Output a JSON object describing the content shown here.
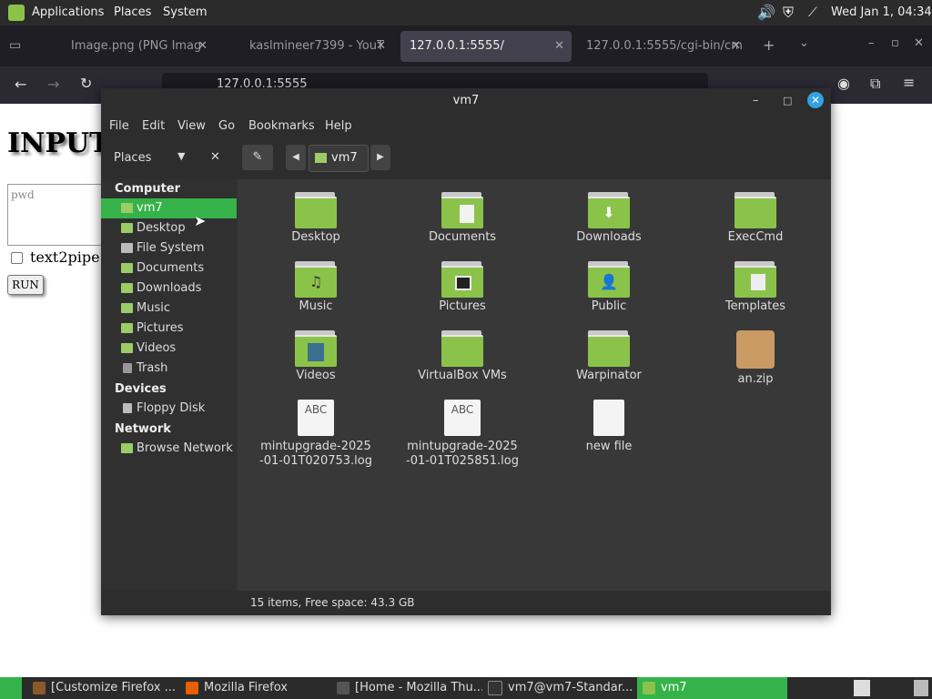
{
  "top_panel": {
    "menus": [
      "Applications",
      "Places",
      "System"
    ],
    "clock": "Wed Jan  1, 04:34"
  },
  "firefox": {
    "tabs": [
      {
        "label": "Image.png (PNG Imag",
        "active": false
      },
      {
        "label": "kaslmineer7399 - YouT",
        "active": false
      },
      {
        "label": "127.0.0.1:5555/",
        "active": true
      },
      {
        "label": "127.0.0.1:5555/cgi-bin/cm",
        "active": false
      }
    ],
    "url": "127.0.0.1:5555"
  },
  "page": {
    "heading": "INPUT",
    "textarea_placeholder": "pwd",
    "checkbox_label": "text2pipe",
    "run_label": "RUN"
  },
  "nemo": {
    "title": "vm7",
    "menu": [
      "File",
      "Edit",
      "View",
      "Go",
      "Bookmarks",
      "Help"
    ],
    "places_label": "Places",
    "path_button": "vm7",
    "sidebar": {
      "computer_header": "Computer",
      "computer": [
        "vm7",
        "Desktop",
        "File System",
        "Documents",
        "Downloads",
        "Music",
        "Pictures",
        "Videos",
        "Trash"
      ],
      "devices_header": "Devices",
      "devices": [
        "Floppy Disk"
      ],
      "network_header": "Network",
      "network": [
        "Browse Network"
      ]
    },
    "items": [
      {
        "name": "Desktop",
        "kind": "folder",
        "emblem": ""
      },
      {
        "name": "Documents",
        "kind": "folder",
        "emblem": "doc"
      },
      {
        "name": "Downloads",
        "kind": "folder",
        "emblem": "down"
      },
      {
        "name": "ExecCmd",
        "kind": "folder",
        "emblem": ""
      },
      {
        "name": "Music",
        "kind": "folder",
        "emblem": "music"
      },
      {
        "name": "Pictures",
        "kind": "folder",
        "emblem": "pic"
      },
      {
        "name": "Public",
        "kind": "folder",
        "emblem": "person"
      },
      {
        "name": "Templates",
        "kind": "folder",
        "emblem": "tmpl"
      },
      {
        "name": "Videos",
        "kind": "folder",
        "emblem": "film"
      },
      {
        "name": "VirtualBox VMs",
        "kind": "folder",
        "emblem": ""
      },
      {
        "name": "Warpinator",
        "kind": "folder",
        "emblem": ""
      },
      {
        "name": "an.zip",
        "kind": "zip",
        "emblem": ""
      },
      {
        "name": "mintupgrade-2025-01-01T020753.log",
        "kind": "text",
        "emblem": ""
      },
      {
        "name": "mintupgrade-2025-01-01T025851.log",
        "kind": "text",
        "emblem": ""
      },
      {
        "name": "new file",
        "kind": "blank",
        "emblem": ""
      }
    ],
    "text_icon_label": "ABC",
    "status": "15 items, Free space: 43.3 GB"
  },
  "taskbar": {
    "items": [
      {
        "label": "[Customize Firefox ...",
        "active": false,
        "color": "#8a5a2b"
      },
      {
        "label": "Mozilla Firefox",
        "active": false,
        "color": "#e66000"
      },
      {
        "label": "[Home - Mozilla Thu...",
        "active": false,
        "color": "#555555"
      },
      {
        "label": "vm7@vm7-Standar...",
        "active": false,
        "color": "#333333"
      },
      {
        "label": "vm7",
        "active": true,
        "color": "#8bc34a"
      }
    ]
  },
  "colors": {
    "accent": "#35b34a",
    "folder": "#8bc34a",
    "close": "#35a1e0"
  }
}
